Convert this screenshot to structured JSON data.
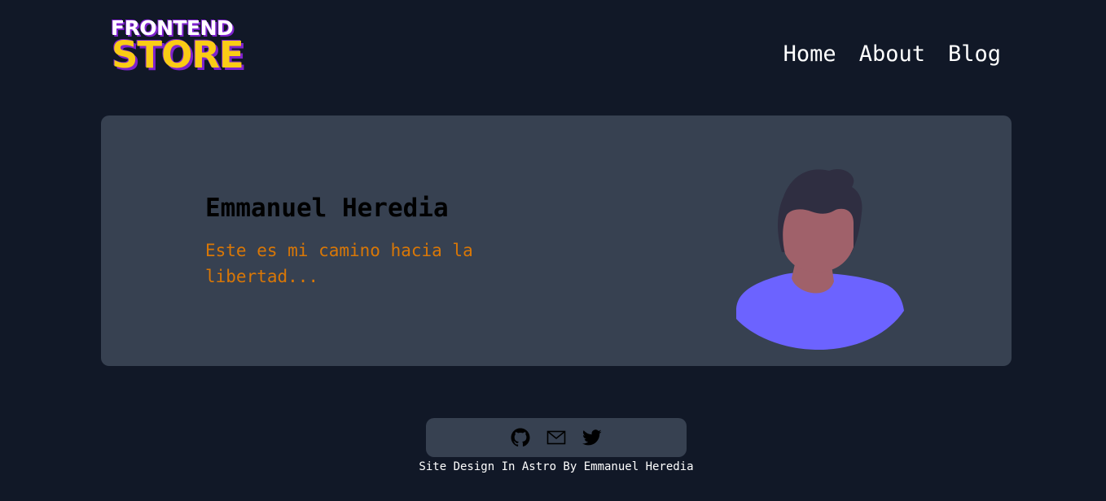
{
  "header": {
    "logo_line1": "FRONTEND",
    "logo_line2": "STORE",
    "nav": [
      {
        "label": "Home"
      },
      {
        "label": "About"
      },
      {
        "label": "Blog"
      }
    ]
  },
  "hero": {
    "name": "Emmanuel Heredia",
    "tagline": "Este es mi camino hacia la libertad...",
    "avatar_icon": "person-avatar-icon"
  },
  "footer": {
    "links": [
      {
        "icon": "github-icon"
      },
      {
        "icon": "mail-icon"
      },
      {
        "icon": "twitter-icon"
      }
    ],
    "credit": "Site Design In Astro By Emmanuel Heredia"
  },
  "colors": {
    "background": "#111827",
    "card": "#374151",
    "logo_yellow": "#facc15",
    "logo_purple": "#7e22ce",
    "tagline": "#d97706",
    "avatar_shirt": "#6c63ff",
    "avatar_skin": "#a0616a",
    "avatar_hair": "#2f2e41"
  }
}
